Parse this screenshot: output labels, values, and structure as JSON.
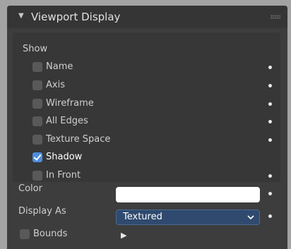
{
  "panel": {
    "title": "Viewport Display"
  },
  "show": {
    "label": "Show",
    "options": [
      {
        "label": "Name",
        "checked": false
      },
      {
        "label": "Axis",
        "checked": false
      },
      {
        "label": "Wireframe",
        "checked": false
      },
      {
        "label": "All Edges",
        "checked": false
      },
      {
        "label": "Texture Space",
        "checked": false
      },
      {
        "label": "Shadow",
        "checked": true
      },
      {
        "label": "In Front",
        "checked": false
      }
    ]
  },
  "color": {
    "label": "Color",
    "value": "#ffffff"
  },
  "display_as": {
    "label": "Display As",
    "value": "Textured"
  },
  "bounds": {
    "label": "Bounds",
    "checked": false
  },
  "colors": {
    "accent": "#4d8ee0",
    "select_bg": "#2f4a6e"
  }
}
